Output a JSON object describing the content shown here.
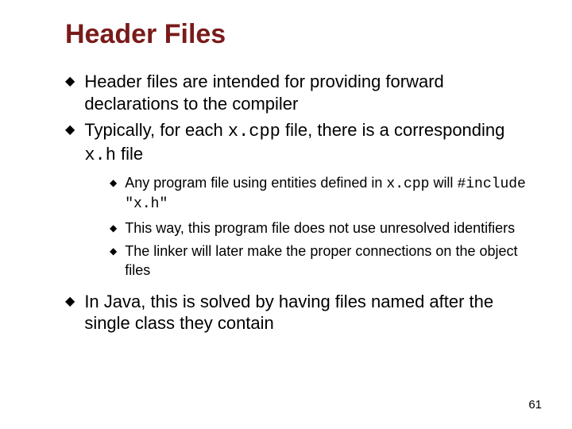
{
  "title": "Header Files",
  "bullets": {
    "b1": {
      "text": "Header files are intended for providing forward declarations to the compiler"
    },
    "b2": {
      "prefix": "Typically, for each ",
      "code1": "x.cpp",
      "middle": " file, there is a corresponding ",
      "code2": "x.h",
      "suffix": " file"
    },
    "nested": {
      "n1": {
        "prefix": "Any program file using entities defined in ",
        "code1": "x.cpp",
        "middle": " will ",
        "code2": "#include \"x.h\""
      },
      "n2": {
        "text": "This way, this program file does not use unresolved identifiers"
      },
      "n3": {
        "text": "The linker will later make the proper connections on the object files"
      }
    },
    "b3": {
      "text": "In Java, this is solved by having files named after the single class they contain"
    }
  },
  "page_number": "61",
  "marker_glyph": "◆"
}
